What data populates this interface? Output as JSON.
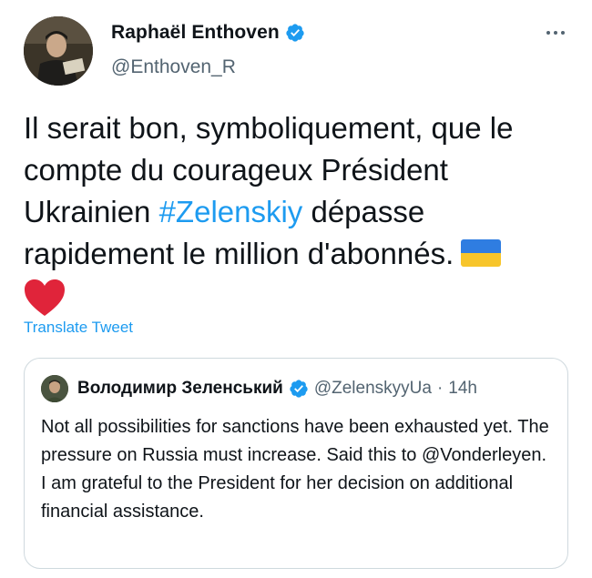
{
  "author": {
    "display_name": "Raphaël Enthoven",
    "handle": "@Enthoven_R",
    "avatar_icon": "avatar-photo",
    "verified": true
  },
  "tweet": {
    "text_part1": "Il serait bon, symboliquement, que le compte du courageux Président Ukrainien ",
    "hashtag": "#Zelenskiy",
    "text_part2": " dépasse rapidement le million d'abonnés.",
    "emojis": [
      "ukraine-flag-icon",
      "red-heart-icon"
    ]
  },
  "translate_label": "Translate Tweet",
  "quote": {
    "display_name": "Володимир Зеленський",
    "handle": "@ZelenskyyUa",
    "separator": "·",
    "time": "14h",
    "text": "Not all possibilities for sanctions have been exhausted yet. The pressure on Russia must increase. Said this to @Vonderleyen. I am grateful to the President for her decision on additional financial assistance."
  },
  "colors": {
    "accent": "#1d9bf0",
    "text": "#0f1419",
    "secondary": "#536471",
    "border": "#cfd9de",
    "flag_blue": "#2f7de1",
    "flag_yellow": "#f7c52b",
    "heart": "#e0243a"
  }
}
